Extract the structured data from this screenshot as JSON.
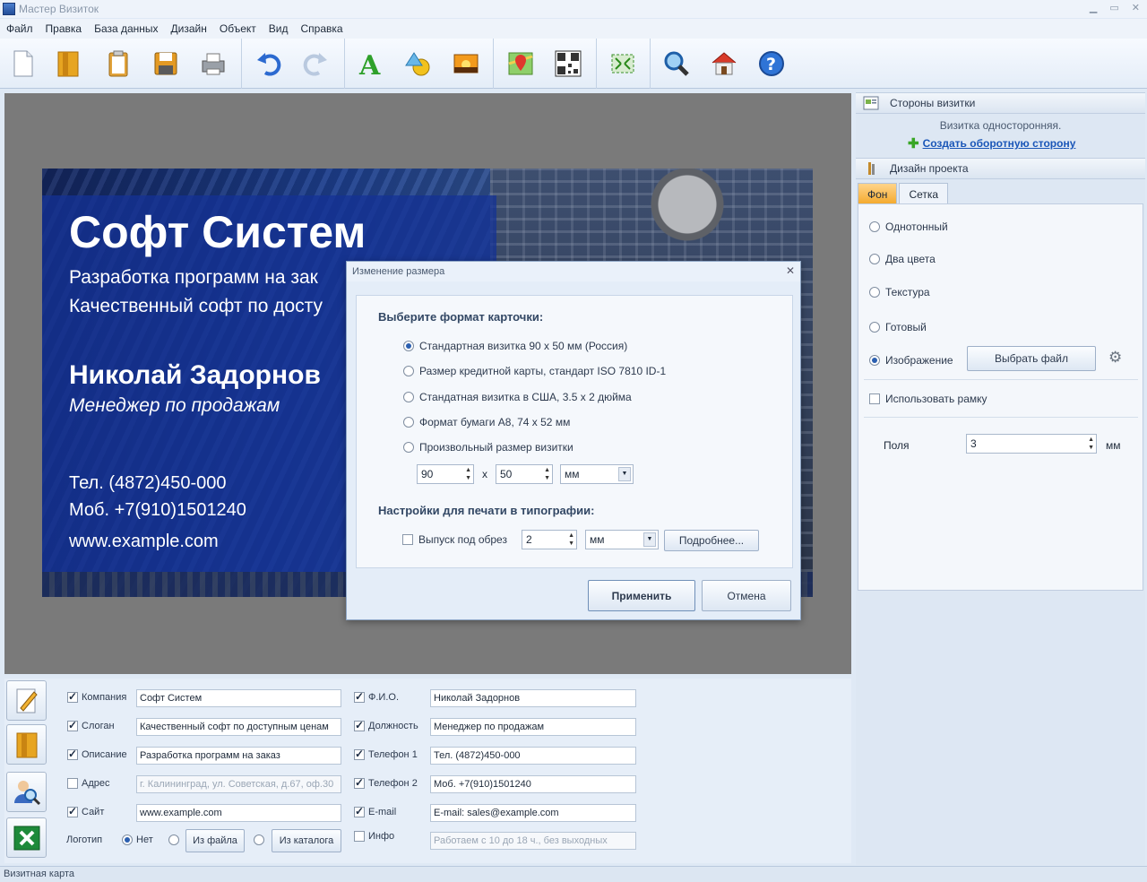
{
  "window": {
    "title": "Мастер Визиток"
  },
  "menu": [
    "Файл",
    "Правка",
    "База данных",
    "Дизайн",
    "Объект",
    "Вид",
    "Справка"
  ],
  "toolbar_icons": [
    "new-file-icon",
    "open-folder-icon",
    "clipboard-icon",
    "save-icon",
    "print-icon",
    "undo-icon",
    "redo-icon",
    "text-icon",
    "shapes-icon",
    "image-icon",
    "map-icon",
    "qr-code-icon",
    "resize-icon",
    "zoom-icon",
    "home-icon",
    "help-icon"
  ],
  "card": {
    "company": "Софт Систем",
    "slogan1": "Разработка программ на зак",
    "slogan2": "Качественный софт по досту",
    "name": "Николай Задорнов",
    "position": "Менеджер по продажам",
    "tel": "Тел. (4872)450-000",
    "mob": "Моб. +7(910)1501240",
    "www": "www.example.com"
  },
  "dialog": {
    "title": "Изменение размера",
    "choose_header": "Выберите формат карточки:",
    "options": [
      "Стандартная визитка 90 x 50 мм (Россия)",
      "Размер кредитной карты, стандарт ISO 7810 ID-1",
      "Стандатная визитка в США, 3.5 x 2 дюйма",
      "Формат бумаги А8, 74 x 52 мм",
      "Произвольный размер визитки"
    ],
    "selected_option": 0,
    "width": "90",
    "x": "x",
    "height": "50",
    "unit": "мм",
    "print_header": "Настройки для печати в типографии:",
    "bleed_label": "Выпуск под обрез",
    "bleed_value": "2",
    "bleed_unit": "мм",
    "more_button": "Подробнее...",
    "apply_button": "Применить",
    "cancel_button": "Отмена"
  },
  "right_panel": {
    "sides_header": "Стороны визитки",
    "sides_info": "Визитка односторонняя.",
    "create_back_link": "Создать оборотную сторону",
    "design_header": "Дизайн проекта",
    "tabs": [
      "Фон",
      "Сетка"
    ],
    "bg_options": [
      "Однотонный",
      "Два цвета",
      "Текстура",
      "Готовый",
      "Изображение"
    ],
    "bg_selected": 4,
    "choose_file_button": "Выбрать файл",
    "use_frame_label": "Использовать рамку",
    "margins_label": "Поля",
    "margins_value": "3",
    "margins_unit": "мм"
  },
  "fields_left": [
    {
      "label": "Компания",
      "checked": true,
      "value": "Софт Систем"
    },
    {
      "label": "Слоган",
      "checked": true,
      "value": "Качественный софт по доступным ценам"
    },
    {
      "label": "Описание",
      "checked": true,
      "value": "Разработка программ на заказ"
    },
    {
      "label": "Адрес",
      "checked": false,
      "value": "г. Калининград, ул. Советская, д.67, оф.30"
    },
    {
      "label": "Сайт",
      "checked": true,
      "value": "www.example.com"
    }
  ],
  "fields_right": [
    {
      "label": "Ф.И.О.",
      "checked": true,
      "value": "Николай Задорнов"
    },
    {
      "label": "Должность",
      "checked": true,
      "value": "Менеджер по продажам"
    },
    {
      "label": "Телефон 1",
      "checked": true,
      "value": "Тел. (4872)450-000"
    },
    {
      "label": "Телефон 2",
      "checked": true,
      "value": "Моб. +7(910)1501240"
    },
    {
      "label": "E-mail",
      "checked": true,
      "value": "E-mail: sales@example.com"
    },
    {
      "label": "Инфо",
      "checked": false,
      "value": "Работаем с 10 до 18 ч., без выходных"
    }
  ],
  "logo": {
    "label": "Логотип",
    "none_label": "Нет",
    "from_file_button": "Из файла",
    "from_catalog_button": "Из каталога"
  },
  "statusbar": {
    "text": "Визитная карта"
  }
}
